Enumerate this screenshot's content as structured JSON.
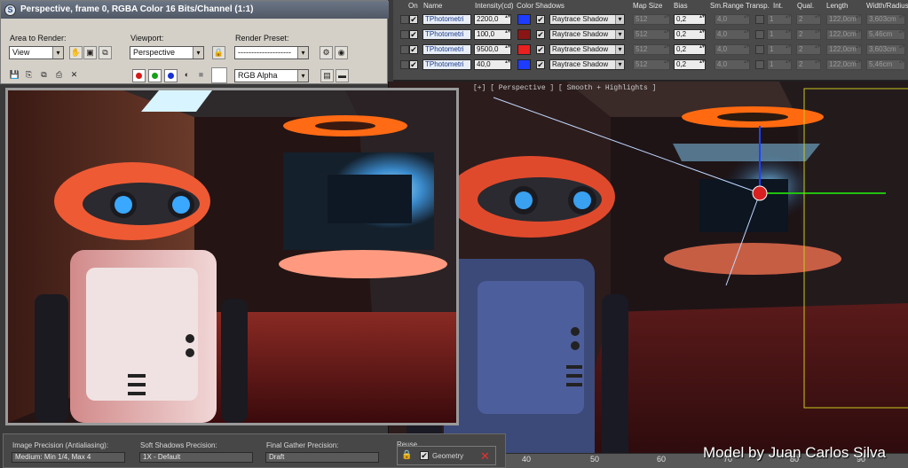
{
  "render_window": {
    "title": "Perspective, frame 0, RGBA Color 16 Bits/Channel (1:1)",
    "area_label": "Area to Render:",
    "area_value": "View",
    "viewport_label": "Viewport:",
    "viewport_value": "Perspective",
    "preset_label": "Render Preset:",
    "preset_value": "--------------------",
    "channel_value": "RGB Alpha"
  },
  "light_lister": {
    "headers": {
      "on": "On",
      "name": "Name",
      "intensity": "Intensity(cd)",
      "color": "Color",
      "shadows": "Shadows",
      "map_size": "Map Size",
      "bias": "Bias",
      "sm_range": "Sm.Range",
      "transp": "Transp.",
      "int": "Int.",
      "qual": "Qual.",
      "length": "Length",
      "width": "Width/Radius"
    },
    "rows": [
      {
        "name": "TPhotometri",
        "intensity": "2200,0",
        "color": "#1e3cff",
        "shadow": "Raytrace Shadow",
        "map_size": "512",
        "bias": "0,2",
        "sm_range": "4,0",
        "int": "1",
        "qual": "2",
        "length": "122,0cm",
        "width": "3,603cm"
      },
      {
        "name": "TPhotometri",
        "intensity": "100,0",
        "color": "#8a1515",
        "shadow": "Raytrace Shadow",
        "map_size": "512",
        "bias": "0,2",
        "sm_range": "4,0",
        "int": "1",
        "qual": "2",
        "length": "122,0cm",
        "width": "5,46cm"
      },
      {
        "name": "TPhotometri",
        "intensity": "9500,0",
        "color": "#e82020",
        "shadow": "Raytrace Shadow",
        "map_size": "512",
        "bias": "0,2",
        "sm_range": "4,0",
        "int": "1",
        "qual": "2",
        "length": "122,0cm",
        "width": "3,603cm"
      },
      {
        "name": "TPhotometri",
        "intensity": "40,0",
        "color": "#1e3cff",
        "shadow": "Raytrace Shadow",
        "map_size": "512",
        "bias": "0,2",
        "sm_range": "4,0",
        "int": "1",
        "qual": "2",
        "length": "122,0cm",
        "width": "5,46cm"
      }
    ]
  },
  "viewport": {
    "label": "[+] [ Perspective ] [ Smooth + Highlights ]"
  },
  "settings": {
    "image_precision_label": "Image Precision (Antialiasing):",
    "image_precision_value": "Medium: Min 1/4, Max 4",
    "soft_shadows_label": "Soft Shadows Precision:",
    "soft_shadows_value": "1X - Default",
    "final_gather_label": "Final Gather Precision:",
    "final_gather_value": "Draft",
    "reuse_label": "Reuse",
    "geometry_label": "Geometry"
  },
  "timeline": {
    "ticks": [
      "40",
      "50",
      "60",
      "70",
      "80",
      "90"
    ]
  },
  "credit": "Model by Juan Carlos Silva"
}
